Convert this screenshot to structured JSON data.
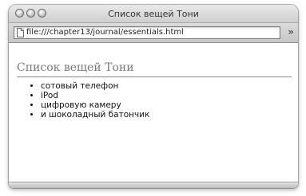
{
  "window": {
    "title": "Список вещей Тони"
  },
  "toolbar": {
    "address": "file:///chapter13/journal/essentials.html",
    "more_label": "»"
  },
  "page": {
    "heading": "Список вещей Тони",
    "items": [
      "сотовый телефон",
      "iPod",
      "цифровую камеру",
      "и шоколадный батончик"
    ]
  }
}
